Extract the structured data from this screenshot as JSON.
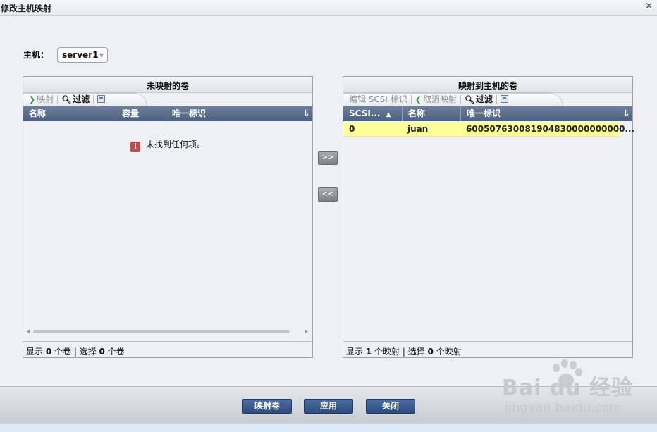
{
  "window": {
    "title": "修改主机映射",
    "close_glyph": "×"
  },
  "host": {
    "label": "主机：",
    "selected": "server1"
  },
  "unmapped_panel": {
    "title": "未映射的卷",
    "toolbar": {
      "map_label": "映射",
      "filter_label": "过滤"
    },
    "columns": [
      "名称",
      "容量",
      "唯一标识"
    ],
    "empty_message": "未找到任何项。",
    "status": {
      "show_prefix": "显示 ",
      "show_count": "0",
      "show_suffix": " 个卷 ",
      "sep": "|",
      "select_prefix": " 选择 ",
      "select_count": "0",
      "select_suffix": " 个卷"
    }
  },
  "mapped_panel": {
    "title": "映射到主机的卷",
    "toolbar": {
      "edit_label": "编辑 SCSI 标识",
      "unmap_label": "取消映射",
      "filter_label": "过滤"
    },
    "columns": [
      "SCSI...",
      "名称",
      "唯一标识"
    ],
    "rows": [
      {
        "scsi": "0",
        "name": "juan",
        "uid": "600507630081904830000000000..."
      }
    ],
    "status": {
      "show_prefix": "显示 ",
      "show_count": "1",
      "show_suffix": " 个映射 ",
      "sep": "|",
      "select_prefix": " 选择 ",
      "select_count": "0",
      "select_suffix": " 个映射"
    }
  },
  "transfer": {
    "add_label": ">>",
    "remove_label": "<<"
  },
  "footer": {
    "map_volume_label": "映射卷",
    "apply_label": "应用",
    "close_label": "关闭"
  },
  "watermark": {
    "logo": "Bai  du 经验",
    "url": "jingyan.baidu.com"
  }
}
